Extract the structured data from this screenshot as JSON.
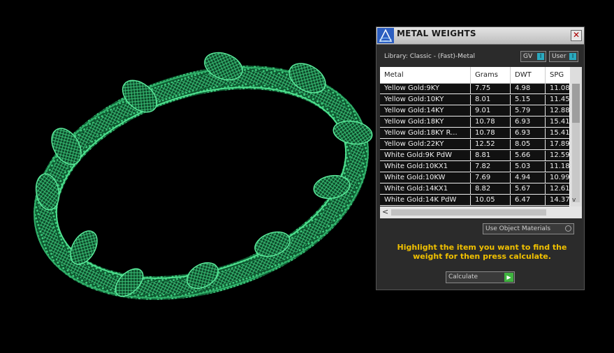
{
  "panel": {
    "title": "METAL WEIGHTS",
    "close_label": "✕",
    "library_label": "Library: Classic - (Fast)-Metal",
    "gv_toggle": "GV",
    "user_toggle": "User",
    "toggle_knob_glyph": "I",
    "use_object_materials": "Use Object Materials",
    "instruction": "Highlight the item you want to find the weight for then press calculate.",
    "calculate_label": "Calculate",
    "calculate_glyph": "▶",
    "scroll_down_glyph": "v",
    "scroll_left_glyph": "<"
  },
  "table": {
    "columns": [
      "Metal",
      "Grams",
      "DWT",
      "SPG"
    ],
    "rows": [
      [
        "Yellow Gold:9KY",
        "7.75",
        "4.98",
        "11.08"
      ],
      [
        "Yellow Gold:10KY",
        "8.01",
        "5.15",
        "11.45"
      ],
      [
        "Yellow Gold:14KY",
        "9.01",
        "5.79",
        "12.88"
      ],
      [
        "Yellow Gold:18KY",
        "10.78",
        "6.93",
        "15.41"
      ],
      [
        "Yellow Gold:18KY R...",
        "10.78",
        "6.93",
        "15.41"
      ],
      [
        "Yellow Gold:22KY",
        "12.52",
        "8.05",
        "17.89"
      ],
      [
        "White Gold:9K PdW",
        "8.81",
        "5.66",
        "12.59"
      ],
      [
        "White Gold:10KX1",
        "7.82",
        "5.03",
        "11.18"
      ],
      [
        "White Gold:10KW",
        "7.69",
        "4.94",
        "10.99"
      ],
      [
        "White Gold:14KX1",
        "8.82",
        "5.67",
        "12.61"
      ],
      [
        "White Gold:14K PdW",
        "10.05",
        "6.47",
        "14.37"
      ]
    ]
  },
  "colors": {
    "accent_toggle": "#2aa9bf",
    "instruction_text": "#f0c000",
    "model_green": "#1f9a5a"
  }
}
